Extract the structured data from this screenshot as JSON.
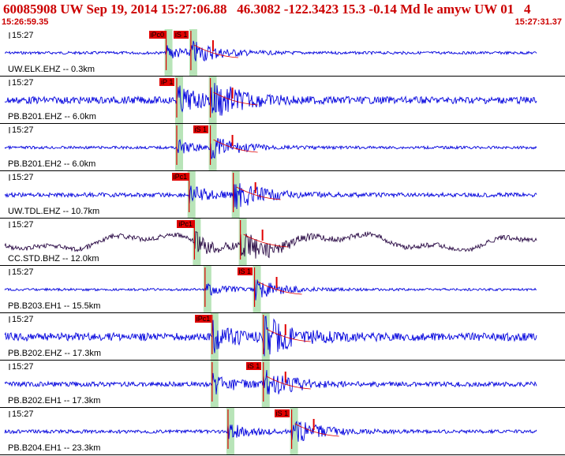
{
  "header": {
    "title": "60085908 UW Sep 19, 2014 15:27:06.88   46.3082 -122.3423 15.3 -0.14 Md le amyw UW 01   4",
    "time_start": "15:26:59.35",
    "time_end": "15:27:31.37"
  },
  "colors": {
    "header_text": "#cc0000",
    "trace": "#0000dd",
    "trace_dark": "#2a0a45",
    "pick": "#e00000",
    "window": "#b8e4b8",
    "divider": "#000000"
  },
  "traces": [
    {
      "station": "UW.ELK.EHZ -- 0.3km",
      "time_label": "15:27",
      "pick_label": "iPc0",
      "s_label": "iS 1",
      "p_sec": 9.4,
      "s_sec": 10.8,
      "amp": 0.35,
      "dark": false
    },
    {
      "station": "PB.B201.EHZ -- 6.0km",
      "time_label": "15:27",
      "pick_label": "iP 1",
      "s_label": "",
      "p_sec": 10.0,
      "s_sec": 11.9,
      "amp": 0.9,
      "dark": false
    },
    {
      "station": "PB.B201.EH2 -- 6.0km",
      "time_label": "15:27",
      "pick_label": "",
      "s_label": "iS 1",
      "p_sec": 10.0,
      "s_sec": 11.9,
      "amp": 0.35,
      "dark": false
    },
    {
      "station": "UW.TDL.EHZ -- 10.7km",
      "time_label": "15:27",
      "pick_label": "iPc1",
      "s_label": "",
      "p_sec": 10.7,
      "s_sec": 13.2,
      "amp": 0.55,
      "dark": false
    },
    {
      "station": "CC.STD.BHZ -- 12.0km",
      "time_label": "15:27",
      "pick_label": "iPc1",
      "s_label": "",
      "p_sec": 11.0,
      "s_sec": 13.6,
      "amp": 0.6,
      "dark": true
    },
    {
      "station": "PB.B203.EH1 -- 15.5km",
      "time_label": "15:27",
      "pick_label": "",
      "s_label": "iS 1",
      "p_sec": 11.6,
      "s_sec": 14.4,
      "amp": 0.3,
      "dark": false
    },
    {
      "station": "PB.B202.EHZ -- 17.3km",
      "time_label": "15:27",
      "pick_label": "iPc1",
      "s_label": "",
      "p_sec": 12.0,
      "s_sec": 14.9,
      "amp": 1.0,
      "dark": false
    },
    {
      "station": "PB.B202.EH1 -- 17.3km",
      "time_label": "15:27",
      "pick_label": "",
      "s_label": "iS 1",
      "p_sec": 12.0,
      "s_sec": 14.9,
      "amp": 0.6,
      "dark": false
    },
    {
      "station": "PB.B204.EH1 -- 23.3km",
      "time_label": "15:27",
      "pick_label": "",
      "s_label": "iS 1",
      "p_sec": 12.9,
      "s_sec": 16.5,
      "amp": 0.45,
      "dark": false
    }
  ]
}
